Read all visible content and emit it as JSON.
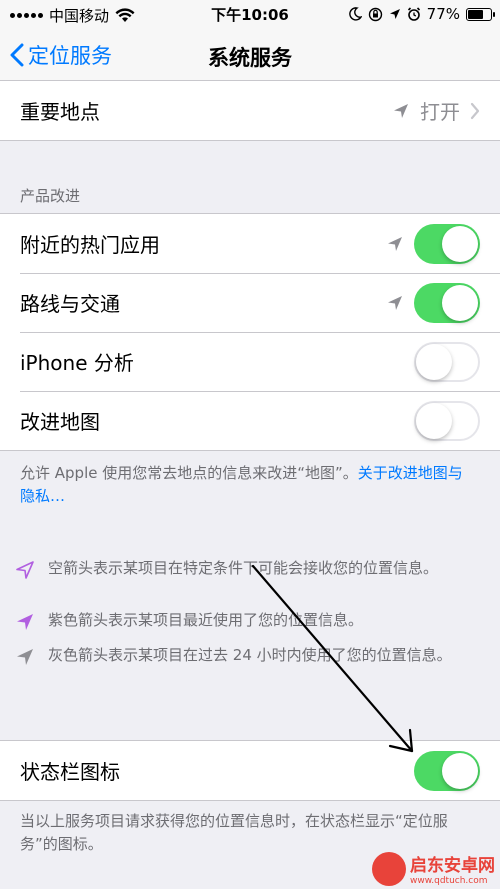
{
  "status_bar": {
    "carrier": "中国移动",
    "time": "下午10:06",
    "battery_text": "77%",
    "battery_level": 0.77
  },
  "nav": {
    "back_label": "定位服务",
    "title": "系统服务"
  },
  "top_row": {
    "label": "重要地点",
    "value": "打开"
  },
  "product_section": {
    "header": "产品改进",
    "rows": [
      {
        "label": "附近的热门应用",
        "toggle": "on",
        "arrow": true
      },
      {
        "label": "路线与交通",
        "toggle": "on",
        "arrow": true
      },
      {
        "label": "iPhone 分析",
        "toggle": "off",
        "arrow": false
      },
      {
        "label": "改进地图",
        "toggle": "off",
        "arrow": false
      }
    ],
    "footer_text": "允许 Apple 使用您常去地点的信息来改进“地图”。",
    "footer_link": "关于改进地图与隐私…"
  },
  "legend": {
    "hollow_arrow_text": "空箭头表示某项目在特定条件下可能会接收您的位置信息。",
    "purple_arrow_text": "紫色箭头表示某项目最近使用了您的位置信息。",
    "gray_arrow_text": "灰色箭头表示某项目在过去 24 小时内使用了您的位置信息。"
  },
  "status_icon_row": {
    "label": "状态栏图标",
    "toggle": "on",
    "footer_text": "当以上服务项目请求获得您的位置信息时，在状态栏显示“定位服务”的图标。"
  },
  "colors": {
    "accent": "#007aff",
    "toggle_on": "#4cd964",
    "purple_arrow": "#b15fe0",
    "gray_arrow": "#8e8e93"
  },
  "watermark": {
    "title": "启东安卓网",
    "url": "www.qdtuch.com"
  }
}
